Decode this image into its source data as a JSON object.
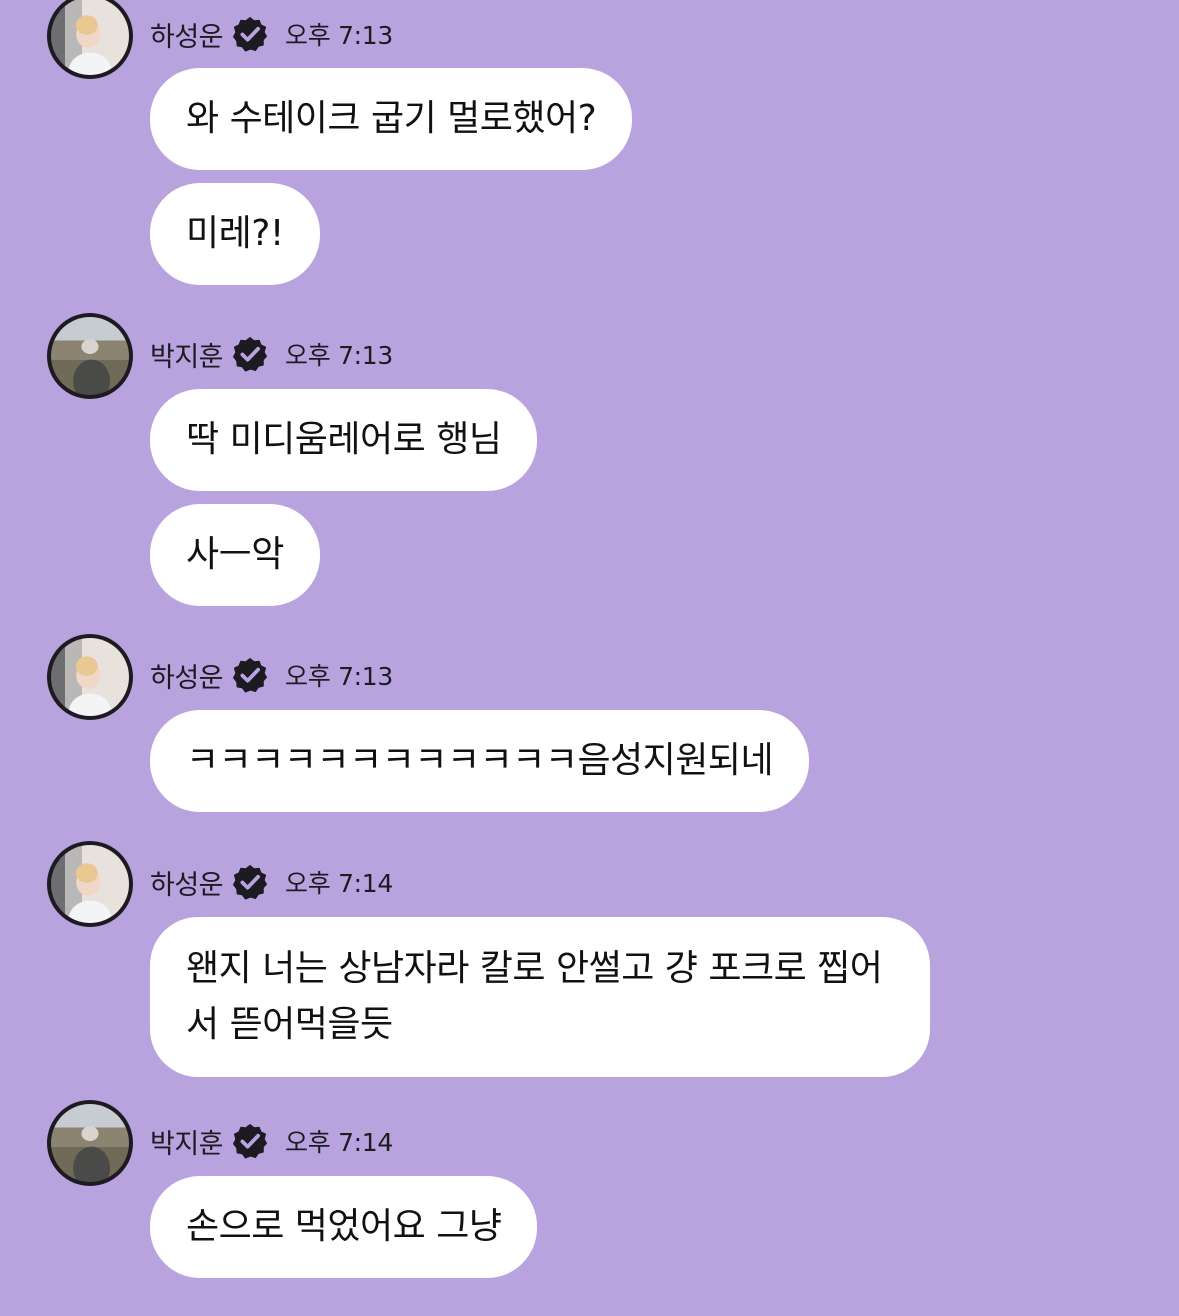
{
  "messages": [
    {
      "sender": "하성운",
      "avatar": "sender-avatar-haseongun",
      "time": "오후 7:13",
      "bubbles": [
        "와 수테이크 굽기 멀로했어?",
        "미레?!"
      ]
    },
    {
      "sender": "박지훈",
      "avatar": "sender-avatar-parkjihoon",
      "time": "오후 7:13",
      "bubbles": [
        "딱 미디움레어로 행님",
        "사ㅡ악"
      ]
    },
    {
      "sender": "하성운",
      "avatar": "sender-avatar-haseongun",
      "time": "오후 7:13",
      "bubbles": [
        "ㅋㅋㅋㅋㅋㅋㅋㅋㅋㅋㅋㅋ음성지원되네"
      ]
    },
    {
      "sender": "하성운",
      "avatar": "sender-avatar-haseongun",
      "time": "오후 7:14",
      "bubbles": [
        "왠지 너는 상남자라 칼로 안썰고 걍 포크로 찝어서 뜯어먹을듯"
      ]
    },
    {
      "sender": "박지훈",
      "avatar": "sender-avatar-parkjihoon",
      "time": "오후 7:14",
      "bubbles": [
        "손으로 먹었어요 그냥"
      ]
    }
  ],
  "icons": {
    "verified": "verified-badge-icon"
  },
  "colors": {
    "background": "#b8a3df",
    "bubble": "#ffffff",
    "text": "#1d1b21"
  }
}
